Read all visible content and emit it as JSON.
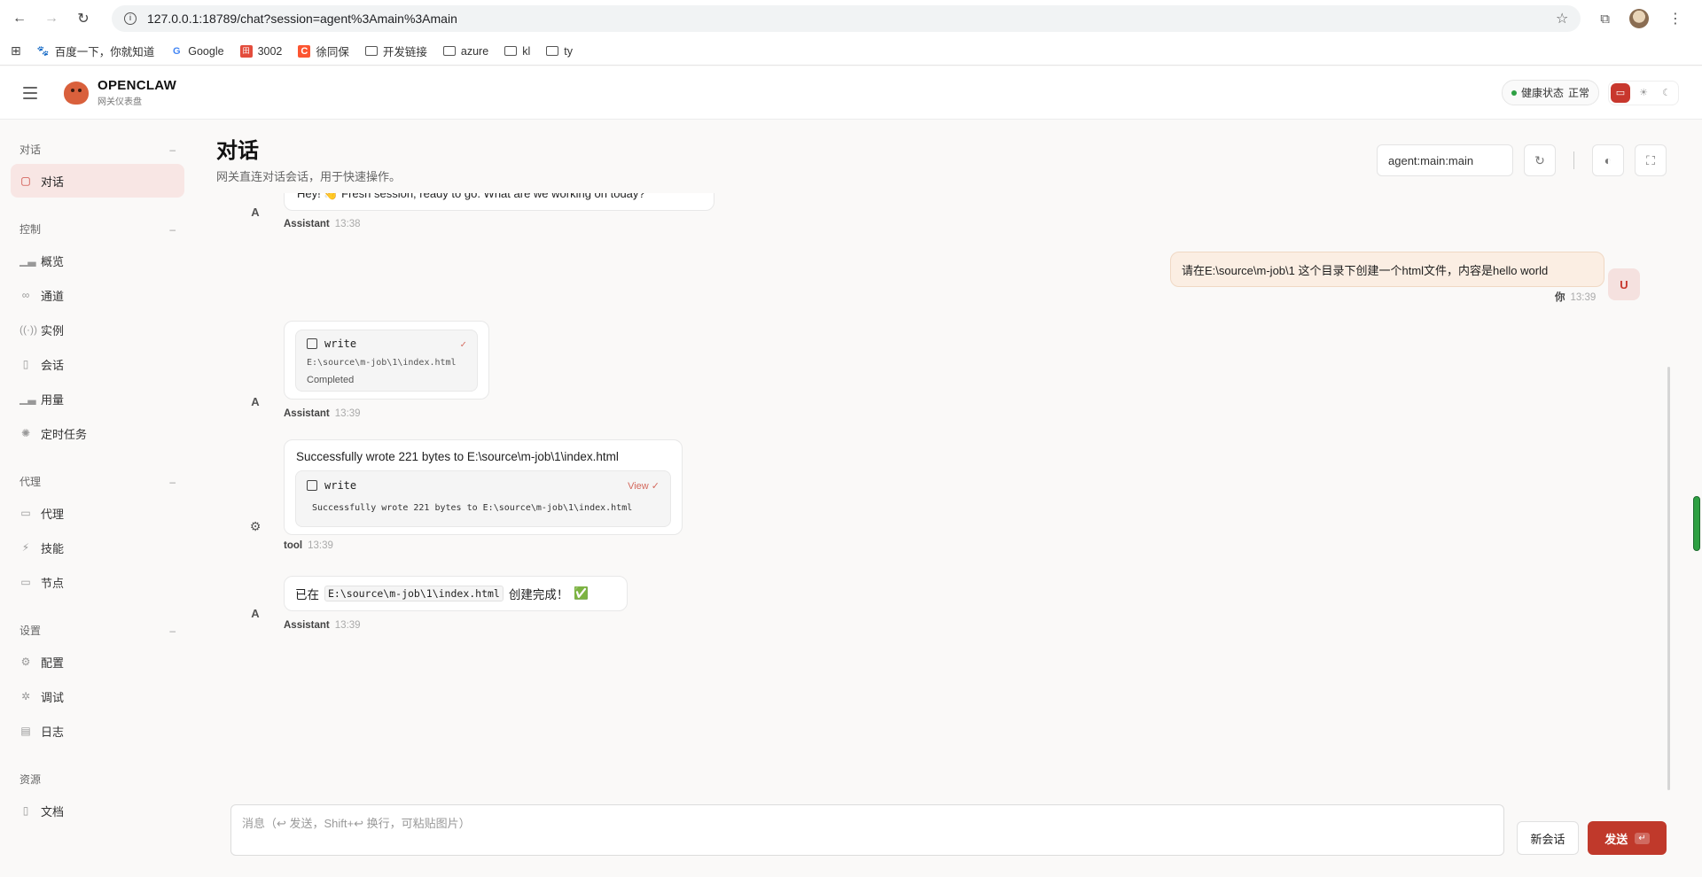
{
  "browser": {
    "url": "127.0.0.1:18789/chat?session=agent%3Amain%3Amain",
    "bookmarks": [
      {
        "label": "百度一下，你就知道",
        "icon": "baidu-icon"
      },
      {
        "label": "Google",
        "icon": "google-icon"
      },
      {
        "label": "3002",
        "icon": "app-icon"
      },
      {
        "label": "徐同保",
        "icon": "csdn-icon"
      },
      {
        "label": "开发链接",
        "icon": "folder-icon"
      },
      {
        "label": "azure",
        "icon": "folder-icon"
      },
      {
        "label": "kl",
        "icon": "folder-icon"
      },
      {
        "label": "ty",
        "icon": "folder-icon"
      }
    ]
  },
  "header": {
    "brand": "OPENCLAW",
    "brand_sub": "网关仪表盘",
    "health_label": "健康状态",
    "health_value": "正常"
  },
  "sidebar": {
    "sections": [
      {
        "title": "对话",
        "items": [
          {
            "label": "对话",
            "icon": "chat-icon",
            "active": true
          }
        ]
      },
      {
        "title": "控制",
        "items": [
          {
            "label": "概览",
            "icon": "bar-chart-icon"
          },
          {
            "label": "通道",
            "icon": "link-icon"
          },
          {
            "label": "实例",
            "icon": "radio-icon"
          },
          {
            "label": "会话",
            "icon": "file-icon"
          },
          {
            "label": "用量",
            "icon": "bar-chart-icon"
          },
          {
            "label": "定时任务",
            "icon": "spinner-icon"
          }
        ]
      },
      {
        "title": "代理",
        "items": [
          {
            "label": "代理",
            "icon": "folder-icon"
          },
          {
            "label": "技能",
            "icon": "bolt-icon"
          },
          {
            "label": "节点",
            "icon": "monitor-icon"
          }
        ]
      },
      {
        "title": "设置",
        "items": [
          {
            "label": "配置",
            "icon": "gear-icon"
          },
          {
            "label": "调试",
            "icon": "bug-icon"
          },
          {
            "label": "日志",
            "icon": "log-icon"
          }
        ]
      },
      {
        "title": "资源",
        "items": [
          {
            "label": "文档",
            "icon": "book-icon"
          }
        ]
      }
    ]
  },
  "main": {
    "title": "对话",
    "subtitle": "网关直连对话会话，用于快速操作。",
    "session": "agent:main:main"
  },
  "messages": {
    "m1": {
      "avatar": "A",
      "text": "Hey! 👋 Fresh session, ready to go. What are we working on today?",
      "sender": "Assistant",
      "time": "13:38"
    },
    "m2": {
      "avatar": "U",
      "text": "请在E:\\source\\m-job\\1 这个目录下创建一个html文件，内容是hello world",
      "sender": "你",
      "time": "13:39"
    },
    "m3": {
      "avatar": "A",
      "tool": "write",
      "path": "E:\\source\\m-job\\1\\index.html",
      "status": "Completed",
      "sender": "Assistant",
      "time": "13:39"
    },
    "m4": {
      "avatar": "⚙",
      "text": "Successfully wrote 221 bytes to E:\\source\\m-job\\1\\index.html",
      "tool": "write",
      "view": "View",
      "output": "Successfully wrote 221 bytes to E:\\source\\m-job\\1\\index.html",
      "sender": "tool",
      "time": "13:39"
    },
    "m5": {
      "avatar": "A",
      "pre": "已在",
      "code": "E:\\source\\m-job\\1\\index.html",
      "post": "创建完成！",
      "emoji": "✅",
      "sender": "Assistant",
      "time": "13:39"
    }
  },
  "composer": {
    "placeholder": "消息（↩ 发送，Shift+↩ 换行，可粘贴图片）",
    "new_session": "新会话",
    "send": "发送",
    "send_key": "↵"
  }
}
